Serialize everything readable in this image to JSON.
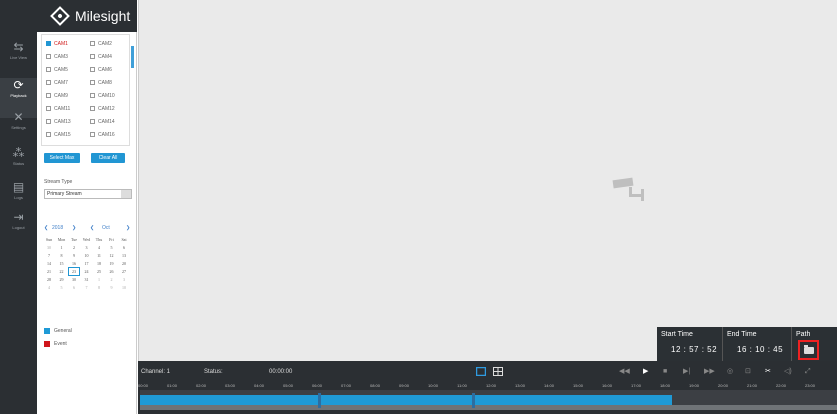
{
  "app": {
    "logo_text": "Milesight",
    "logo_icon": "milesight-logo-icon"
  },
  "nav": [
    {
      "label": "Live View",
      "icon": "live-view-icon",
      "glyph": "⇆"
    },
    {
      "label": "Playback",
      "icon": "playback-icon",
      "glyph": "⟳"
    },
    {
      "label": "Settings",
      "icon": "settings-icon",
      "glyph": "✕"
    },
    {
      "label": "Status",
      "icon": "status-icon",
      "glyph": "⁂"
    },
    {
      "label": "Logs",
      "icon": "logs-icon",
      "glyph": "▤"
    },
    {
      "label": "Logout",
      "icon": "logout-icon",
      "glyph": "⇥"
    }
  ],
  "cameras": [
    "CAM1",
    "CAM2",
    "CAM3",
    "CAM4",
    "CAM5",
    "CAM6",
    "CAM7",
    "CAM8",
    "CAM9",
    "CAM10",
    "CAM11",
    "CAM12",
    "CAM13",
    "CAM14",
    "CAM15",
    "CAM16"
  ],
  "selected_camera": "CAM1",
  "buttons": {
    "select_max": "Select Max",
    "clear_all": "Clear All"
  },
  "stream": {
    "label": "Stream Type",
    "value": "Primary Stream"
  },
  "calendar": {
    "year": "2018",
    "month": "Oct",
    "prev_glyph": "❮",
    "next_glyph": "❯",
    "weekdays": [
      "Sun",
      "Mon",
      "Tue",
      "Wed",
      "Thu",
      "Fri",
      "Sat"
    ],
    "weeks": [
      [
        "30",
        "1",
        "2",
        "3",
        "4",
        "5",
        "6"
      ],
      [
        "7",
        "8",
        "9",
        "10",
        "11",
        "12",
        "13"
      ],
      [
        "14",
        "15",
        "16",
        "17",
        "18",
        "19",
        "20"
      ],
      [
        "21",
        "22",
        "23",
        "24",
        "25",
        "26",
        "27"
      ],
      [
        "28",
        "29",
        "30",
        "31",
        "1",
        "2",
        "3"
      ],
      [
        "4",
        "5",
        "6",
        "7",
        "8",
        "9",
        "10"
      ]
    ],
    "selected_day": "23"
  },
  "legend": [
    {
      "label": "General",
      "color": "#1f9ad6"
    },
    {
      "label": "Event",
      "color": "#d0161b"
    }
  ],
  "time_box": {
    "start_label": "Start Time",
    "start_value": "12 : 57 : 52",
    "end_label": "End Time",
    "end_value": "16 : 10 : 45",
    "path_label": "Path"
  },
  "bottom": {
    "channel": "Channel: 1",
    "status": "Status:",
    "time": "00:00:00",
    "hours": [
      "00:00",
      "01:00",
      "02:00",
      "03:00",
      "04:00",
      "05:00",
      "06:00",
      "07:00",
      "08:00",
      "09:00",
      "10:00",
      "11:00",
      "12:00",
      "13:00",
      "14:00",
      "15:00",
      "16:00",
      "17:00",
      "18:00",
      "19:00",
      "20:00",
      "21:00",
      "22:00",
      "23:00"
    ]
  },
  "colors": {
    "accent": "#2196d3",
    "timeline": "#1f9ad6",
    "highlight": "#e02020"
  }
}
